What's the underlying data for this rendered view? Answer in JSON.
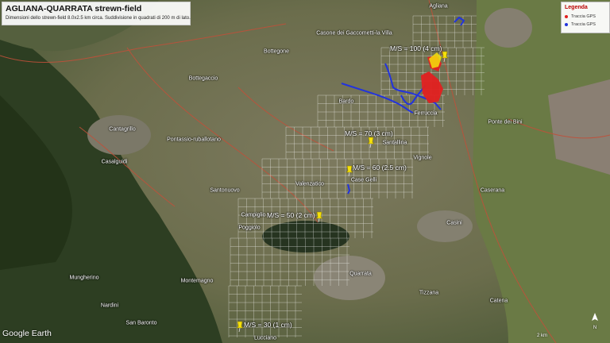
{
  "header": {
    "title": "AGLIANA-QUARRATA strewn-field",
    "subtitle": "Dimensioni dello strewn-field 8.0x2.5 km circa. Suddivisione in quadrati di 200 m di lato."
  },
  "legend": {
    "title": "Legenda",
    "items": [
      {
        "label": "Traccia GPS",
        "color": "#e22020"
      },
      {
        "label": "Traccia GPS",
        "color": "#2233dd"
      }
    ]
  },
  "places": [
    "Agliana",
    "Casone dei Gaccometti-la Villa",
    "Bottegone",
    "Bottegaccio",
    "Bardo",
    "Ferruccia",
    "Ponte dei Bini",
    "Cantagrillo",
    "Pontassio-ruballotano",
    "Casalguidi",
    "Santonuovo",
    "Valenzatico",
    "Case Gelli",
    "Caserana",
    "Campiglio",
    "Poggiolo",
    "Casini",
    "Quarrata",
    "Tizzana",
    "Catena",
    "Montemagno",
    "Mungherino",
    "Nardini",
    "San Baronto",
    "Lucciano",
    "Vignole",
    "Santallina"
  ],
  "pins": [
    {
      "label": "M/S = 100 (4 cm)",
      "color": "#f5e10a"
    },
    {
      "label": "M/S = 70 (3 cm)",
      "color": "#f5e10a"
    },
    {
      "label": "M/S = 60 (2.5 cm)",
      "color": "#f5e10a"
    },
    {
      "label": "M/S = 50 (2 cm)",
      "color": "#f5e10a"
    },
    {
      "label": "M/S = 30 (1 cm)",
      "color": "#f5e10a"
    }
  ],
  "watermark": "Google Earth",
  "compass_label": "N",
  "scale_label": "2 km",
  "colors": {
    "grid": "#ffffff",
    "track_red": "#e22020",
    "track_blue": "#2233dd",
    "road": "#c0503a"
  }
}
